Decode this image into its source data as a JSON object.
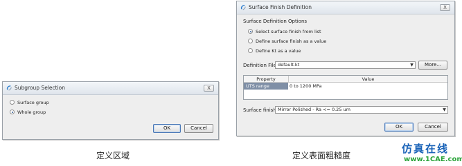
{
  "subgroup_dialog": {
    "title": "Subgroup Selection",
    "close_label": "X",
    "options": [
      {
        "label": "Surface group",
        "selected": false
      },
      {
        "label": "Whole group",
        "selected": true
      }
    ],
    "ok_label": "OK",
    "cancel_label": "Cancel"
  },
  "surface_dialog": {
    "title": "Surface Finish Definition",
    "close_label": "X",
    "options_heading": "Surface Definition Options",
    "options": [
      {
        "label": "Select surface finish from list",
        "selected": true
      },
      {
        "label": "Define surface finish as a value",
        "selected": false
      },
      {
        "label": "Define Kt as a value",
        "selected": false
      }
    ],
    "definition_file_label": "Definition File:",
    "definition_file_value": "default.kt",
    "more_label": "More...",
    "table": {
      "headers": [
        "Property",
        "Value"
      ],
      "rows": [
        {
          "property": "UTS range",
          "value": "0 to 1200 MPa"
        }
      ]
    },
    "surface_finish_label": "Surface finish:",
    "surface_finish_value": "Mirror Polished - Ra <= 0.25 um",
    "ok_label": "OK",
    "cancel_label": "Cancel"
  },
  "captions": {
    "left": "定义区域",
    "right": "定义表面粗糙度"
  },
  "watermark": {
    "text": "仿真在线",
    "url": "www.1CAE.com"
  },
  "colors": {
    "selection_row": "#7f8fa6",
    "watermark_blue": "#1a63b8",
    "watermark_green": "#2aa33a"
  }
}
